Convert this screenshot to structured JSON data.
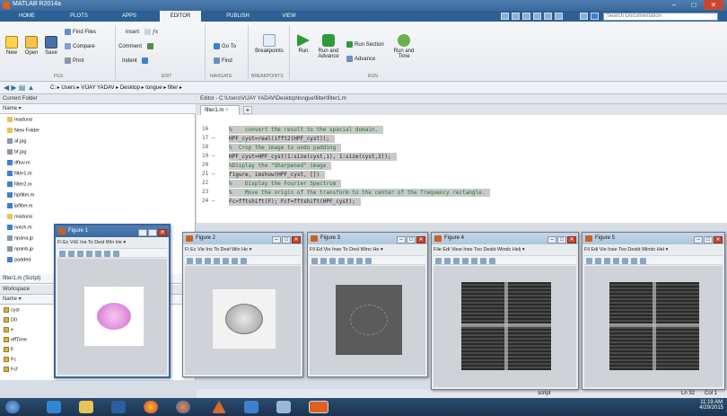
{
  "app": {
    "title": "MATLAB R2014a"
  },
  "window_controls": [
    "–",
    "□",
    "✕"
  ],
  "ribbon_tabs": [
    "HOME",
    "PLOTS",
    "APPS",
    "EDITOR",
    "PUBLISH",
    "VIEW"
  ],
  "active_tab": "EDITOR",
  "search": {
    "placeholder": "Search Documentation"
  },
  "ribbon": {
    "file": {
      "new": "New",
      "open": "Open",
      "save": "Save",
      "find_files": "Find Files",
      "compare": "Compare",
      "print": "Print",
      "section": "FILE"
    },
    "edit": {
      "insert": "Insert",
      "comment": "Comment",
      "indent": "Indent",
      "section": "EDIT"
    },
    "navigate": {
      "goto": "Go To",
      "find": "Find",
      "section": "NAVIGATE"
    },
    "breakpoints": {
      "label": "Breakpoints",
      "section": "BREAKPOINTS"
    },
    "run": {
      "run": "Run",
      "run_and_advance": "Run and Advance",
      "run_section": "Run Section",
      "advance": "Advance",
      "run_and_time": "Run and Time",
      "section": "RUN"
    }
  },
  "address": {
    "path": "C: ▸ Users ▸ VIJAY YADAV ▸ Desktop ▸ tongue ▸ filter ▸"
  },
  "current_folder": {
    "title": "Current Folder",
    "name_header": "Name ▾",
    "items": [
      {
        "name": "madurai",
        "type": "folder"
      },
      {
        "name": "New Folder",
        "type": "folder"
      },
      {
        "name": "af.jpg",
        "type": "image"
      },
      {
        "name": "bf.jpg",
        "type": "image"
      },
      {
        "name": "dftuv.m",
        "type": "mfile"
      },
      {
        "name": "filter1.m",
        "type": "mfile"
      },
      {
        "name": "filter2.m",
        "type": "mfile"
      },
      {
        "name": "hpfilter.m",
        "type": "mfile"
      },
      {
        "name": "lpfilter.m",
        "type": "mfile"
      },
      {
        "name": "madurai",
        "type": "folder"
      },
      {
        "name": "notch.m",
        "type": "mfile"
      },
      {
        "name": "npana.jp",
        "type": "image"
      },
      {
        "name": "npanb.jp",
        "type": "image"
      },
      {
        "name": "padded",
        "type": "mfile"
      }
    ],
    "details": "filter1.m (Script)"
  },
  "workspace": {
    "title": "Workspace",
    "name_header": "Name ▾",
    "items": [
      "cyst",
      "D0",
      "e",
      "effTime",
      "F",
      "Fc",
      "Fcf"
    ]
  },
  "editor": {
    "header": "Editor - C:\\Users\\VIJAY YADAV\\Desktop\\tongue\\filter\\filter1.m",
    "tab": "filter1.m",
    "tab_close": "×",
    "add_tab": "+",
    "lines": [
      {
        "num": "16",
        "text": "%    convert the result to the spacial domain.",
        "comment": true
      },
      {
        "num": "17 –",
        "text": "HPF_cyst=real(ifft2(HPF_cyst));",
        "comment": false
      },
      {
        "num": "18",
        "text": "%  Crop the image to undo padding",
        "comment": true
      },
      {
        "num": "19 –",
        "text": "HPF_cyst=HPF_cyst(1:size(cyst,1), 1:size(cyst,2));",
        "comment": false
      },
      {
        "num": "20",
        "text": "%Display the \"Sharpened\" image",
        "comment": true
      },
      {
        "num": "21 –",
        "text": "figure, imshow(HPF_cyst, [])",
        "comment": false
      },
      {
        "num": "22",
        "text": "%    Display the Fourier Spectrum",
        "comment": true
      },
      {
        "num": "23",
        "text": "%    Move the origin of the transform to the center of the frequency rectangle.",
        "comment": true
      },
      {
        "num": "24 –",
        "text": "Fc=fftshift(F); Fcf=fftshift(HPF_cyst);",
        "comment": false
      }
    ]
  },
  "status": {
    "mode": "script",
    "ln": "Ln 32",
    "col": "Col 1"
  },
  "figures": [
    {
      "title": "Figure 1",
      "menu": "Fi Ec Vi∈ Ins To Desl Win He ▾",
      "image": "pink-cell",
      "active": true
    },
    {
      "title": "Figure 2",
      "menu": "Fi Ec Vie Ins To Desl Win He ▾",
      "image": "gray-cell",
      "active": false
    },
    {
      "title": "Figure 3",
      "menu": "Fil Ed Vie Inse To Desl Winc He ▾",
      "image": "dark-cell",
      "active": false
    },
    {
      "title": "Figure 4",
      "menu": "File Edi View Inse Too Deskt Windc Helj ▾",
      "image": "spectrum",
      "active": false
    },
    {
      "title": "Figure 5",
      "menu": "Fil Edi Vie Inse Too Deskt Windc Hel ▾",
      "image": "spectrum",
      "active": false
    }
  ],
  "clock": {
    "time": "11:19 AM",
    "date": "4/29/2015"
  },
  "colors": {
    "titlebar": "#3a6a9c",
    "tabs": "#2c5f93",
    "active_tab_bg": "#f3f4f6",
    "code_highlight": "#c9c9c9"
  }
}
